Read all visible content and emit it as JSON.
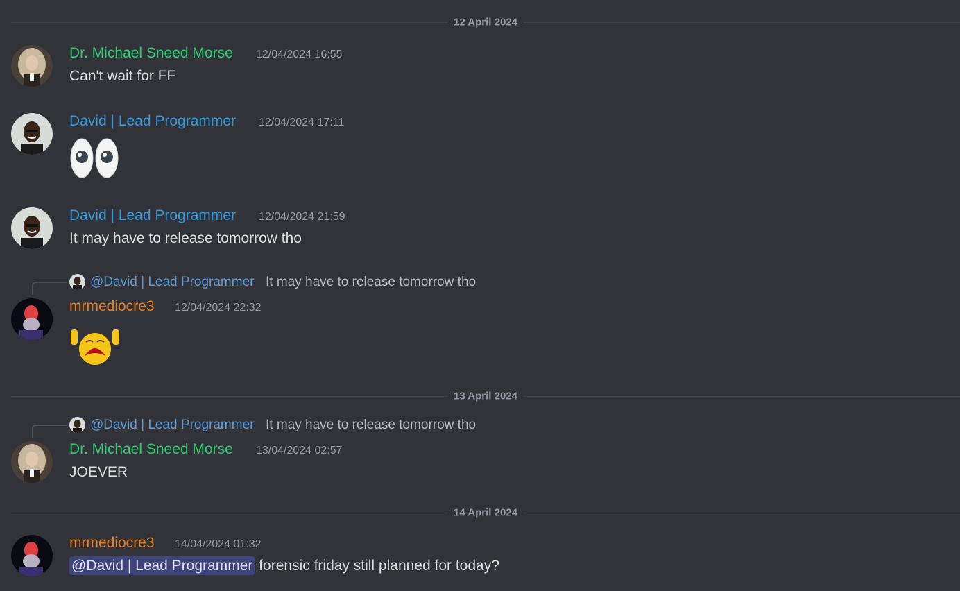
{
  "colors": {
    "background": "#313338",
    "green_role": "#2ecc71",
    "blue_role": "#3498db",
    "orange_role": "#e67e22",
    "mention_bg": "#3c4270"
  },
  "dividers": [
    {
      "label": "12 April 2024"
    },
    {
      "label": "13 April 2024"
    },
    {
      "label": "14 April 2024"
    }
  ],
  "messages": [
    {
      "author": "Dr. Michael Sneed Morse",
      "timestamp": "12/04/2024 16:55",
      "text": "Can't wait for FF"
    },
    {
      "author": "David | Lead Programmer",
      "timestamp": "12/04/2024 17:11",
      "emoji": "eyes-emoji"
    },
    {
      "author": "David | Lead Programmer",
      "timestamp": "12/04/2024 21:59",
      "text": "It may have to release tomorrow tho"
    },
    {
      "reply_author": "@David | Lead Programmer",
      "reply_text": "It may have to release tomorrow tho",
      "author": "mrmediocre3",
      "timestamp": "12/04/2024 22:32",
      "emoji": "sad-hands-up-emoji"
    },
    {
      "reply_author": "@David | Lead Programmer",
      "reply_text": "It may have to release tomorrow tho",
      "author": "Dr. Michael Sneed Morse",
      "timestamp": "13/04/2024 02:57",
      "text": "JOEVER"
    },
    {
      "author": "mrmediocre3",
      "timestamp": "14/04/2024 01:32",
      "mention": "@David | Lead Programmer",
      "text": "forensic friday still planned for today?"
    }
  ]
}
